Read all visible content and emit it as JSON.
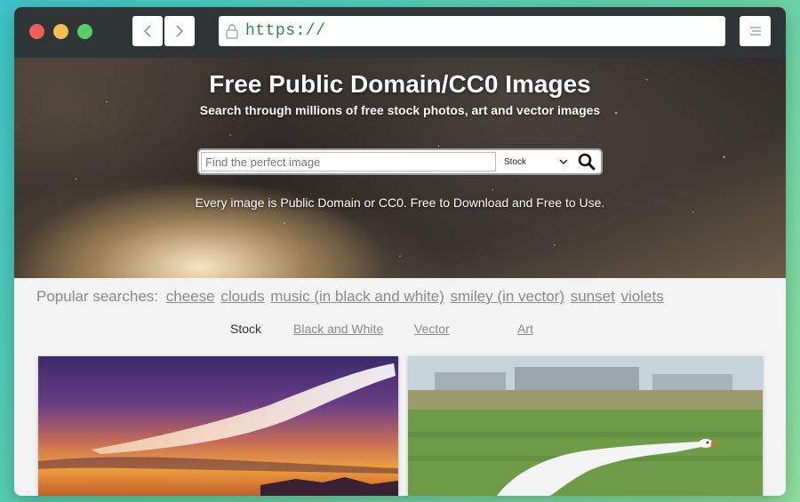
{
  "browser": {
    "url": "https://",
    "icons": {
      "back": "chevron-left-icon",
      "forward": "chevron-right-icon",
      "lock": "lock-icon",
      "menu": "menu-icon"
    }
  },
  "hero": {
    "title": "Free Public Domain/CC0 Images",
    "subtitle": "Search through millions of free stock photos, art and vector images",
    "search": {
      "placeholder": "Find the perfect image",
      "selected_type": "Stock"
    },
    "note": "Every image is Public Domain or CC0. Free to Download and Free to Use."
  },
  "popular": {
    "label": "Popular searches:",
    "links": [
      "cheese",
      "clouds",
      "music (in black and white)",
      "smiley (in vector)",
      "sunset",
      "violets"
    ]
  },
  "tabs": [
    {
      "label": "Stock",
      "active": true
    },
    {
      "label": "Black and White",
      "active": false
    },
    {
      "label": "Vector",
      "active": false
    },
    {
      "label": "Art",
      "active": false
    }
  ],
  "colors": {
    "background_teal": "#3ec3c8",
    "url_green": "#2e8b3a",
    "link_gray": "#8a8a8a"
  }
}
